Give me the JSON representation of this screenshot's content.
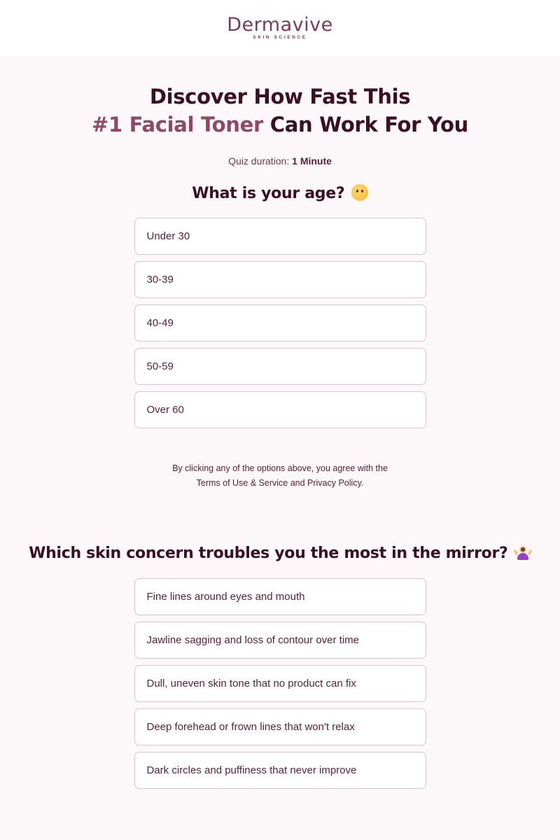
{
  "brand": {
    "name": "Dermavive",
    "tagline": "SKIN SCIENCE",
    "colors": {
      "primary": "#7a3b55",
      "dark": "#3a0f22",
      "accent": "#8c4a66",
      "background": "#fcf7f8"
    }
  },
  "hero": {
    "line1": "Discover How Fast This",
    "accent": "#1 Facial Toner",
    "line2_rest": " Can Work For You"
  },
  "duration": {
    "label": "Quiz duration: ",
    "value": "1 Minute"
  },
  "question1": {
    "title": "What is your age?",
    "emoji": "thinking-face-icon",
    "options": [
      "Under 30",
      "30-39",
      "40-49",
      "50-59",
      "Over 60"
    ]
  },
  "consent": {
    "line1": "By clicking any of the options above, you agree with the",
    "line2": "Terms of Use & Service and Privacy Policy."
  },
  "question2": {
    "title": "Which skin concern troubles you the most in the mirror?",
    "emoji": "person-shrugging-icon",
    "options": [
      "Fine lines around eyes and mouth",
      "Jawline sagging and loss of contour over time",
      "Dull, uneven skin tone that no product can fix",
      "Deep forehead or frown lines that won't relax",
      "Dark circles and puffiness that never improve"
    ]
  }
}
